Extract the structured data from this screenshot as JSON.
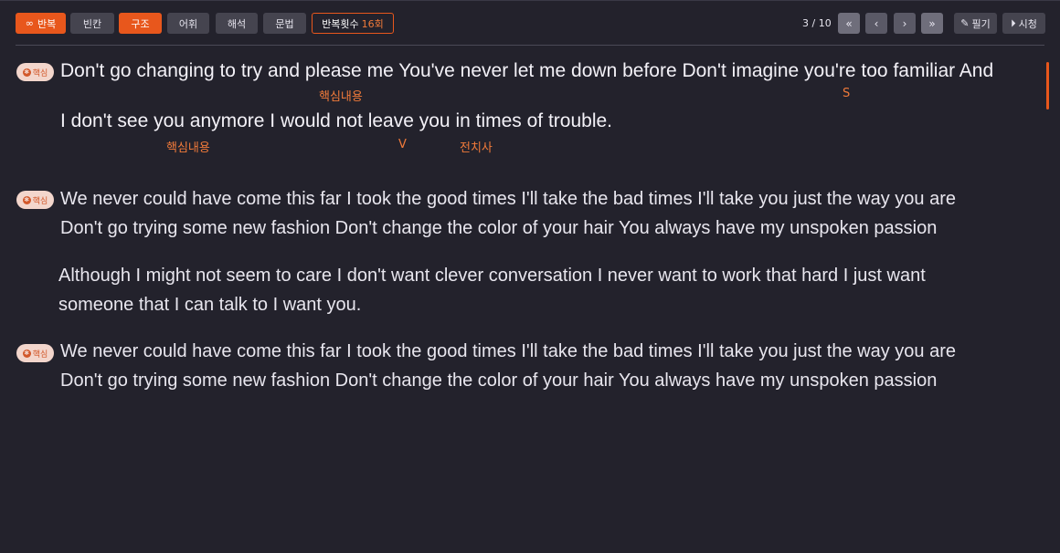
{
  "toolbar": {
    "repeat_label": "반복",
    "blank_label": "빈칸",
    "structure_label": "구조",
    "vocab_label": "어휘",
    "interpret_label": "해석",
    "grammar_label": "문법",
    "repeat_count_label": "반복횟수",
    "repeat_count_value": "16회",
    "page_indicator": "3 / 10",
    "write_label": "필기",
    "watch_label": "시청",
    "accent_color": "#e8571c"
  },
  "content": {
    "badge_label": "핵심",
    "block1": {
      "line1": "Don't go changing to try and please me You've never let me down before Don't imagine you're too familiar And",
      "line2": "I don't see you anymore I would not leave you in times of trouble.",
      "annotations": {
        "a1": "핵심내용",
        "a2": "S",
        "a3": "핵심내용",
        "a4": "V",
        "a5": "전치사"
      }
    },
    "block2": {
      "line1": "We never could have come this far I took the good times I'll take the bad times I'll take you just the way you are",
      "line2": "Don't go trying some new fashion Don't change the color of your hair You always have my unspoken passion"
    },
    "block3": {
      "line1": "Although I might not seem to care I don't want clever conversation I never want to work that hard I just want",
      "line2": "someone that I can talk to I want you."
    },
    "block4": {
      "line1": "We never could have come this far I took the good times I'll take the bad times I'll take you just the way you are",
      "line2": "Don't go trying some new fashion Don't change the color of your hair You always have my unspoken passion"
    }
  }
}
